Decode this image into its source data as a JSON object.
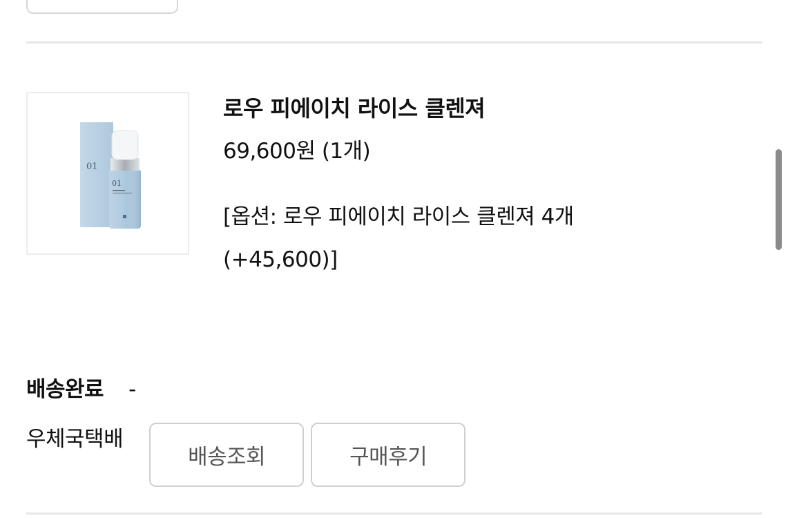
{
  "order_item": {
    "product_name": "로우 피에이치 라이스 클렌져",
    "price_qty": "69,600원 (1개)",
    "option_text": "[옵션: 로우 피에이치 라이스 클렌져 4개 (+45,600)]",
    "image_text": {
      "box_number": "01",
      "bottle_number": "01"
    }
  },
  "delivery": {
    "status": "배송완료",
    "status_detail": "-",
    "carrier": "우체국택배",
    "track_label": "배송조회",
    "review_label": "구매후기"
  },
  "colors": {
    "product_blue": "#b9d2e5",
    "border": "#cfcfcf",
    "divider": "#e6e6e6"
  }
}
